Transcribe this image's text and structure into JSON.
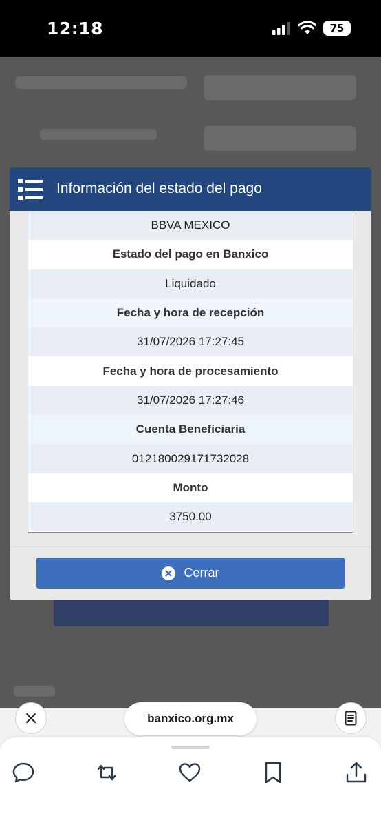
{
  "status_bar": {
    "time": "12:18",
    "battery": "75",
    "icons": [
      "signal-icon",
      "wifi-icon",
      "battery-icon"
    ]
  },
  "modal": {
    "title": "Información del estado del pago",
    "header_icon": "list-icon",
    "rows": [
      {
        "text": "BBVA MEXICO",
        "bold": false
      },
      {
        "text": "Estado del pago en Banxico",
        "bold": true
      },
      {
        "text": "Liquidado",
        "bold": false
      },
      {
        "text": "Fecha y hora de recepción",
        "bold": true
      },
      {
        "text": "31/07/2026 17:27:45",
        "bold": false
      },
      {
        "text": "Fecha y hora de procesamiento",
        "bold": true
      },
      {
        "text": "31/07/2026 17:27:46",
        "bold": false
      },
      {
        "text": "Cuenta Beneficiaria",
        "bold": true
      },
      {
        "text": "012180029171732028",
        "bold": false
      },
      {
        "text": "Monto",
        "bold": true
      },
      {
        "text": "3750.00",
        "bold": false
      }
    ],
    "close_label": "Cerrar"
  },
  "browser": {
    "url": "banxico.org.mx",
    "actions": [
      "reply-icon",
      "repost-icon",
      "like-icon",
      "bookmark-icon",
      "share-icon"
    ]
  },
  "colors": {
    "header_bg": "#25477f",
    "button_bg": "#3f6ebd",
    "row_shade": "#e9eef5",
    "row_light": "#eef6fc"
  }
}
